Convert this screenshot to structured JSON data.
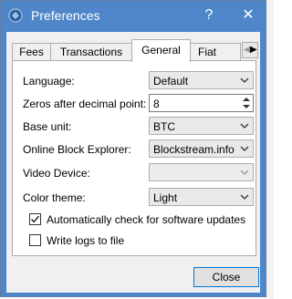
{
  "window": {
    "title": "Preferences",
    "help_glyph": "?",
    "close_glyph": "✕"
  },
  "tabs": [
    {
      "label": "Fees",
      "active": false
    },
    {
      "label": "Transactions",
      "active": false
    },
    {
      "label": "General",
      "active": true
    },
    {
      "label": "Fiat",
      "active": false
    }
  ],
  "tab_scroll": {
    "left": "◀",
    "right": "▶"
  },
  "general": {
    "language": {
      "label": "Language:",
      "value": "Default"
    },
    "zeros": {
      "label": "Zeros after decimal point:",
      "value": "8"
    },
    "base_unit": {
      "label": "Base unit:",
      "value": "BTC"
    },
    "explorer": {
      "label": "Online Block Explorer:",
      "value": "Blockstream.info"
    },
    "video": {
      "label": "Video Device:",
      "value": ""
    },
    "theme": {
      "label": "Color theme:",
      "value": "Light"
    },
    "auto_update": {
      "label": "Automatically check for software updates",
      "checked": true
    },
    "write_logs": {
      "label": "Write logs to file",
      "checked": false
    }
  },
  "footer": {
    "close_label": "Close"
  },
  "colors": {
    "titlebar": "#4f86c9",
    "accent": "#0078d7"
  }
}
